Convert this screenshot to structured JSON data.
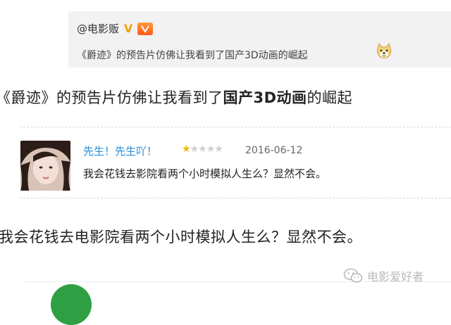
{
  "weibo": {
    "username": "@电影贩",
    "post_text": "《爵迹》的预告片仿佛让我看到了国产3D动画的崛起",
    "verified_icon": "verified-v-icon",
    "emoji_icon": "doge-emoji-icon"
  },
  "headline": {
    "prefix": "《爵迹》的预告片仿佛让我看到了",
    "highlight": "国产3D动画",
    "suffix": "的崛起"
  },
  "comment": {
    "author": "先生！先生吖！",
    "rating_value": 1,
    "rating_max": 5,
    "date": "2016-06-12",
    "text": "我会花钱去影院看两个小时模拟人生么？显然不会。"
  },
  "quote": {
    "text": "我会花钱去电影院看两个小时模拟人生么？显然不会。"
  },
  "watermark": {
    "text": "电影爱好者",
    "icon": "wechat-icon"
  },
  "colors": {
    "weibo_card_bg": "#f2f2f2",
    "comment_name": "#2a8fd6",
    "star_full": "#f5b400",
    "star_empty": "#cfcfcf",
    "watermark": "#b8b8b8",
    "bottom_circle": "#2ea043"
  }
}
